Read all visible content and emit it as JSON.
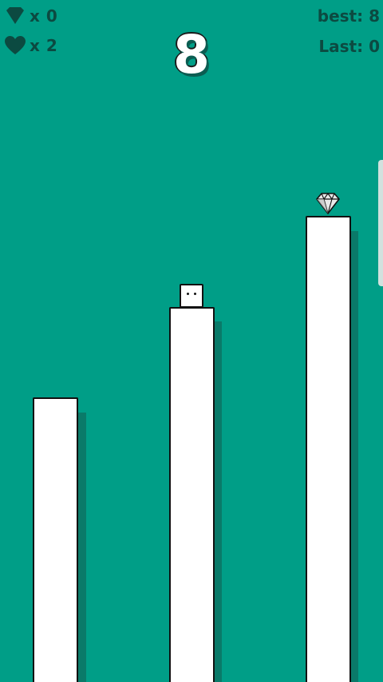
{
  "hud": {
    "gems_text": "x 0",
    "lives_text": "x 2",
    "score": "8",
    "best_text": "best: 8",
    "last_text": "Last: 0"
  },
  "icons": {
    "gem": "gem-icon",
    "heart": "heart-icon"
  },
  "colors": {
    "background": "#009e87",
    "hud_text": "#0c4a41",
    "pillar_shadow": "#0a7a69",
    "pillar": "#ffffff"
  }
}
